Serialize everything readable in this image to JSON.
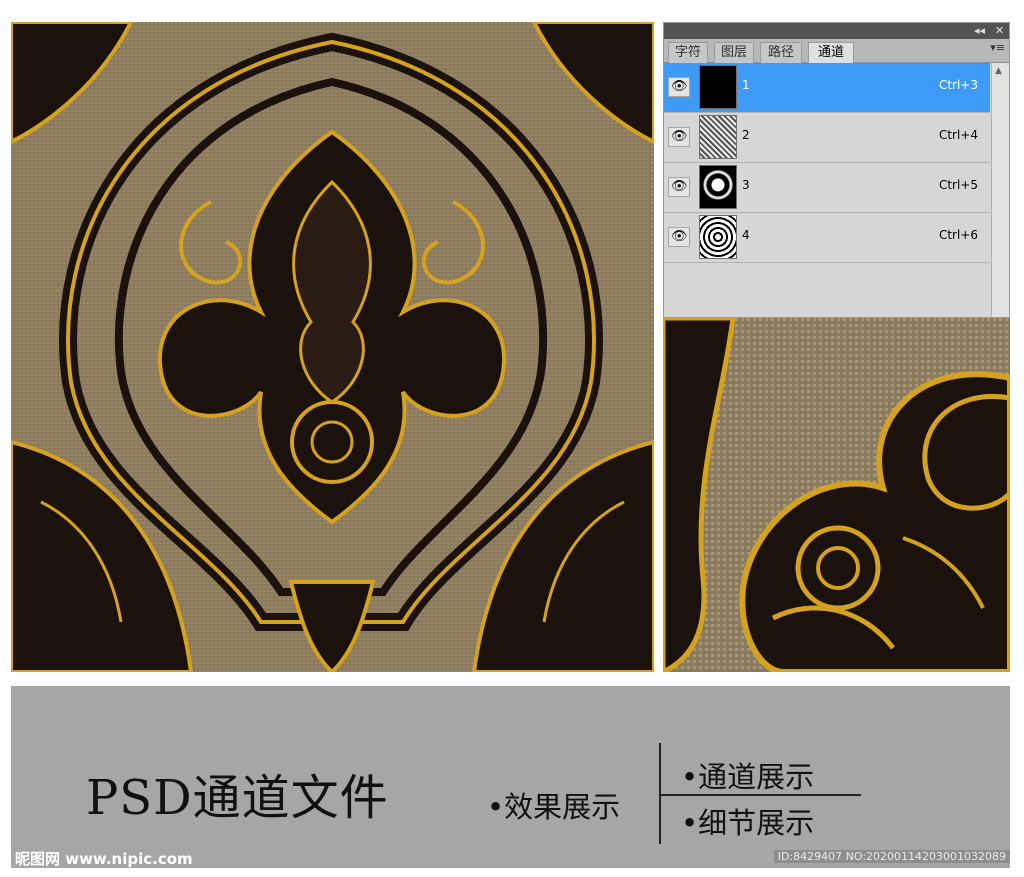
{
  "panel": {
    "tabs": [
      {
        "label": "字符"
      },
      {
        "label": "图层"
      },
      {
        "label": "路径"
      },
      {
        "label": "通道"
      }
    ],
    "active_tab": "通道",
    "collapse_icon": "double-chevron-icon",
    "close_icon": "close-icon",
    "menu_icon": "panel-menu-icon",
    "channels": [
      {
        "name": "1",
        "shortcut": "Ctrl+3",
        "selected": true
      },
      {
        "name": "2",
        "shortcut": "Ctrl+4",
        "selected": false
      },
      {
        "name": "3",
        "shortcut": "Ctrl+5",
        "selected": false
      },
      {
        "name": "4",
        "shortcut": "Ctrl+6",
        "selected": false
      }
    ],
    "selection_color": "#3d9bf7"
  },
  "caption": {
    "title": "PSD通道文件",
    "effect": "•效果展示",
    "channel_show": "•通道展示",
    "detail_show": "•细节展示"
  },
  "watermark": {
    "site": "昵图网 www.nipic.com",
    "id": "ID:8429407 NO:20200114203001032089"
  },
  "colors": {
    "gold": "#d4a21e",
    "dark": "#1c120d",
    "linen": "#8b7a5c",
    "band": "#a6a6a6"
  }
}
